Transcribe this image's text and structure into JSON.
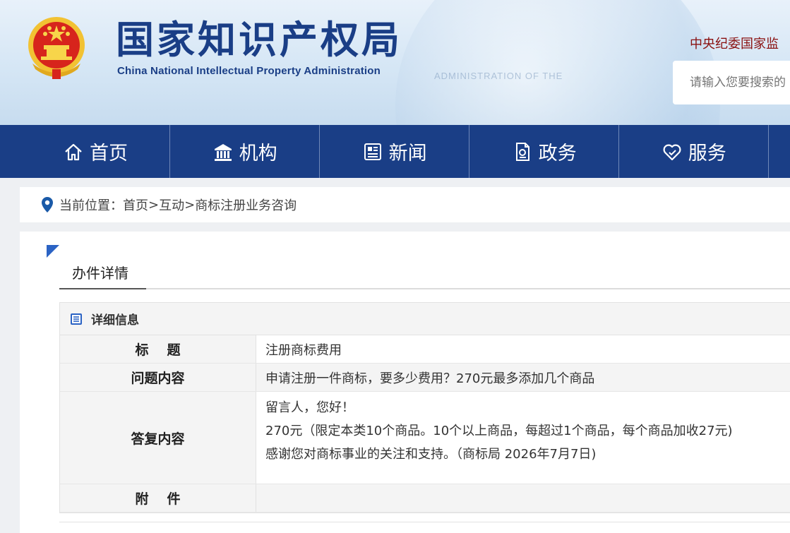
{
  "header": {
    "title_cn": "国家知识产权局",
    "title_en": "China National Intellectual Property Administration",
    "watermark": "ADMINISTRATION  OF THE",
    "top_link": "中央纪委国家监",
    "search_placeholder": "请输入您要搜索的"
  },
  "nav": {
    "items": [
      {
        "label": "首页",
        "icon": "home-icon"
      },
      {
        "label": "机构",
        "icon": "institution-icon"
      },
      {
        "label": "新闻",
        "icon": "news-icon"
      },
      {
        "label": "政务",
        "icon": "government-affairs-icon"
      },
      {
        "label": "服务",
        "icon": "service-icon"
      }
    ]
  },
  "breadcrumb": {
    "prefix": "当前位置：",
    "items": [
      "首页",
      "互动",
      "商标注册业务咨询"
    ],
    "separator": ">"
  },
  "tab": {
    "label": "办件详情"
  },
  "detail": {
    "heading": "详细信息",
    "rows": [
      {
        "key": "标题",
        "value": "注册商标费用"
      },
      {
        "key": "问题内容",
        "value": "申请注册一件商标，要多少费用？270元最多添加几个商品"
      },
      {
        "key": "答复内容",
        "lines": [
          "留言人，您好！",
          "270元（限定本类10个商品。10个以上商品，每超过1个商品，每个商品加收27元)",
          "感谢您对商标事业的关注和支持。（商标局 2026年7月7日)"
        ]
      },
      {
        "key": "附件",
        "value": ""
      }
    ]
  },
  "colors": {
    "nav_bg": "#1a3e86",
    "title": "#1a3e86",
    "accent": "#2b63c4",
    "top_link": "#8a1010"
  }
}
